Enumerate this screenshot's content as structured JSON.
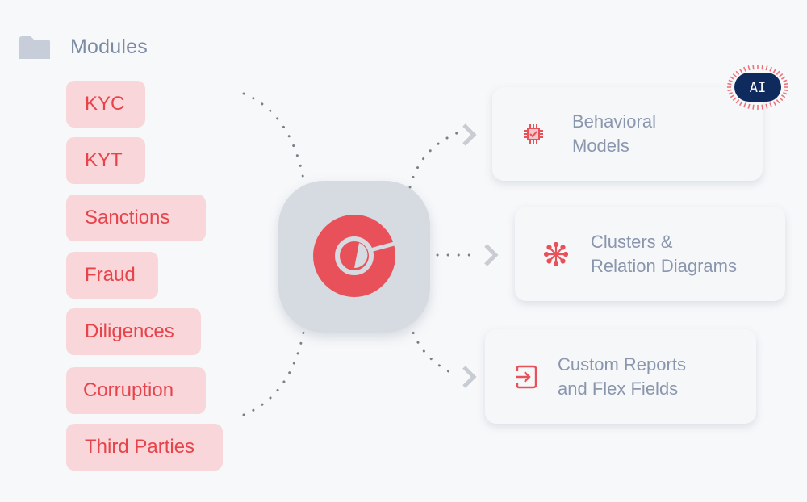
{
  "modules": {
    "title": "Modules",
    "items": [
      {
        "label": "KYC"
      },
      {
        "label": "KYT"
      },
      {
        "label": "Sanctions"
      },
      {
        "label": "Fraud"
      },
      {
        "label": "Diligences"
      },
      {
        "label": "Corruption"
      },
      {
        "label": "Third Parties"
      }
    ]
  },
  "hub": {
    "icon": "search-logo-icon"
  },
  "outputs": [
    {
      "line1": "Behavioral",
      "line2": "Models",
      "icon": "chip-check-icon",
      "badge": "AI"
    },
    {
      "line1": "Clusters &",
      "line2": "Relation Diagrams",
      "icon": "cluster-icon"
    },
    {
      "line1": "Custom Reports",
      "line2": "and Flex Fields",
      "icon": "import-icon"
    }
  ],
  "colors": {
    "accent": "#e8434b",
    "pill_bg": "#f8d6d9",
    "text_muted": "#8a96ad",
    "hub_bg": "#d6dbe2",
    "badge_bg": "#0f2a5c"
  }
}
